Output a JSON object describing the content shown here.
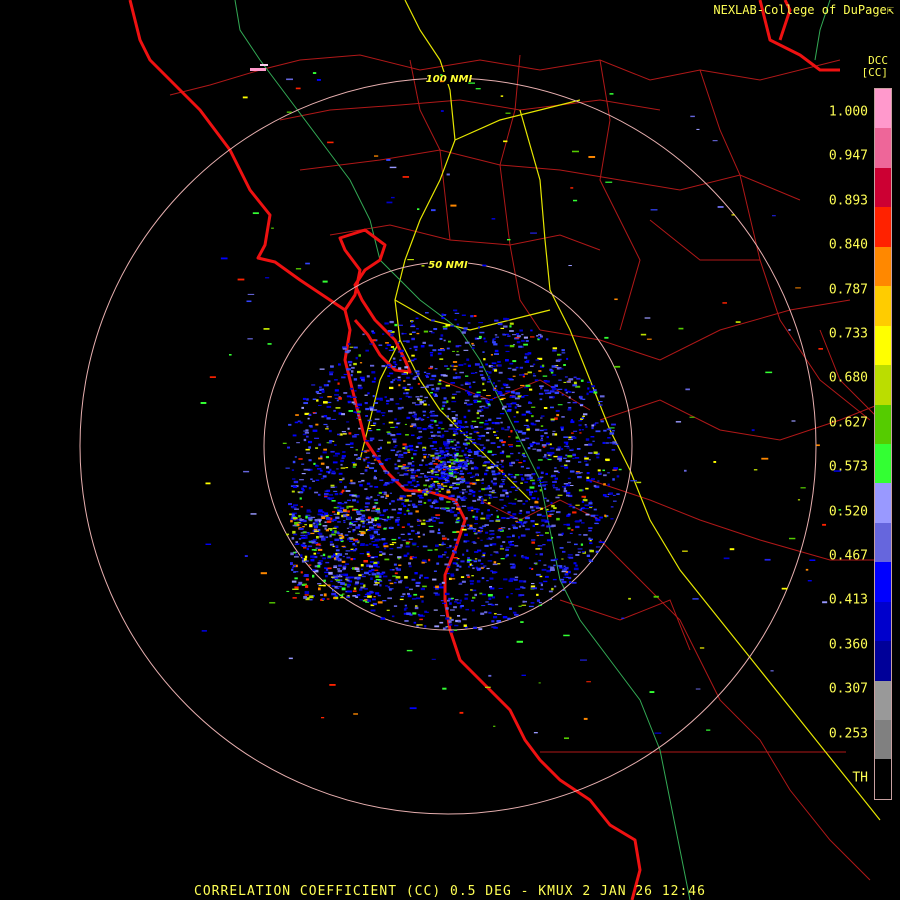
{
  "credit": "NEXLAB-College of DuPage",
  "legend": {
    "product": "DCC",
    "unit": "[CC]",
    "ticks": [
      "1.000",
      "0.947",
      "0.893",
      "0.840",
      "0.787",
      "0.733",
      "0.680",
      "0.627",
      "0.573",
      "0.520",
      "0.467",
      "0.413",
      "0.360",
      "0.307",
      "0.253",
      "TH"
    ],
    "colors": [
      "#ff99cc",
      "#ee6699",
      "#cc0033",
      "#ff2200",
      "#ff8800",
      "#ffcc00",
      "#ffff00",
      "#bbdd00",
      "#55cc00",
      "#33ff33",
      "#9999ff",
      "#6666dd",
      "#0000ff",
      "#0000cc",
      "#000099",
      "#999999",
      "#808080",
      "#000000"
    ]
  },
  "rings": [
    {
      "label": "100 NMI"
    },
    {
      "label": "50 NMI"
    }
  ],
  "bottom_title": "CORRELATION COEFFICIENT (CC) 0.5 DEG - KMUX 2 JAN 26 12:46"
}
